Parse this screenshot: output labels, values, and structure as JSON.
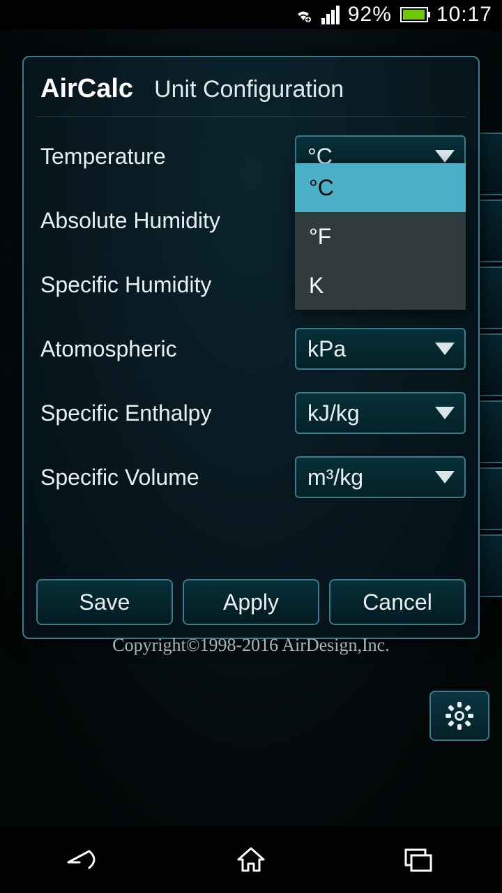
{
  "statusbar": {
    "battery_pct": "92%",
    "time": "10:17"
  },
  "dialog": {
    "app_name": "AirCalc",
    "title": "Unit Configuration",
    "rows": [
      {
        "label": "Temperature",
        "value": "°C"
      },
      {
        "label": "Absolute Humidity",
        "value": ""
      },
      {
        "label": "Specific Humidity",
        "value": ""
      },
      {
        "label": "Atomospheric",
        "value": "kPa"
      },
      {
        "label": "Specific Enthalpy",
        "value": "kJ/kg"
      },
      {
        "label": "Specific Volume",
        "value": "m³/kg"
      }
    ],
    "dropdown": {
      "options": [
        "°C",
        "°F",
        "K"
      ],
      "selected": "°C"
    },
    "buttons": {
      "save": "Save",
      "apply": "Apply",
      "cancel": "Cancel"
    }
  },
  "copyright": "Copyright©1998-2016 AirDesign,Inc."
}
